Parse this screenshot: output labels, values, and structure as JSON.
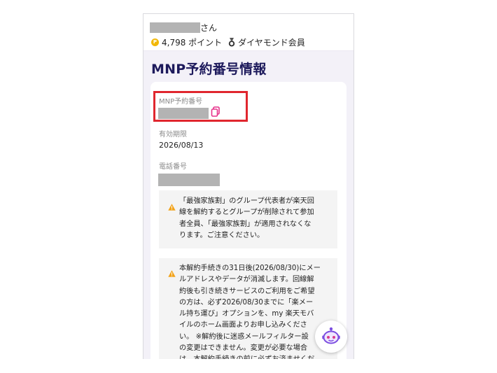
{
  "header": {
    "user_suffix": "さん",
    "points": "4,798 ポイント",
    "member_rank": "ダイヤモンド会員"
  },
  "page": {
    "title": "MNP予約番号情報"
  },
  "fields": {
    "mnp_label": "MNP予約番号",
    "expiry_label": "有効期限",
    "expiry_value": "2026/08/13",
    "phone_label": "電話番号"
  },
  "notices": [
    {
      "text": "「最強家族割」のグループ代表者が楽天回\n線を解約するとグループが削除されて参加\n者全員、「最強家族割」が適用されなくな\nります。ご注意ください。"
    },
    {
      "text": "本解約手続きの31日後(2026/08/30)にメー\nルアドレスやデータが消滅します。回線解\n約後も引き続きサービスのご利用をご希望\nの方は、必ず2026/08/30までに「楽メー\nル持ち運び」オプションを、my 楽天モバ\nイルのホーム画面よりお申し込みくださ\nい。 ※解約後に迷惑メールフィルター設\nの変更はできません。変更が必要な場合\nは、本解約手続きの前に必ずお済ませくだ"
    }
  ],
  "colors": {
    "title": "#1d1a5c",
    "highlight": "#e0262e",
    "copy_icon": "#e6318a",
    "warning": "#f2a31b",
    "coin": "#f2b705"
  },
  "icons": {
    "coin": "point-coin-icon",
    "medal": "medal-icon",
    "copy": "copy-icon",
    "warning": "warning-icon",
    "chat": "chatbot-icon"
  }
}
